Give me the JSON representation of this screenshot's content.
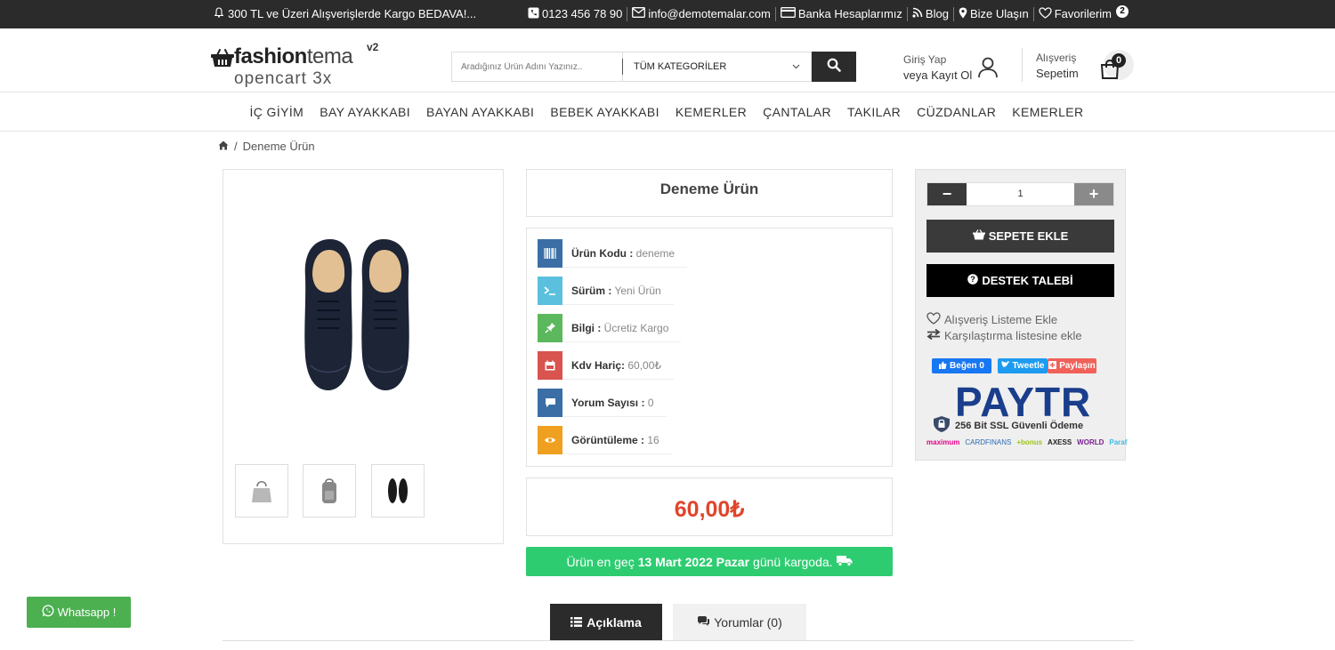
{
  "topbar": {
    "notice": "300 TL ve Üzeri Alışverişlerde Kargo BEDAVA!...",
    "phone": "0123 456 78 90",
    "email": "info@demotemalar.com",
    "bank": "Banka Hesaplarımız",
    "blog": "Blog",
    "contact": "Bize Ulaşın",
    "favorites": "Favorilerim",
    "favorites_count": "2"
  },
  "logo": {
    "part1": "fashion",
    "part2": "tema",
    "version": "v2",
    "sub": "opencart 3x"
  },
  "search": {
    "placeholder": "Aradığınız Ürün Adını Yazınız..",
    "category": "TÜM KATEGORİLER"
  },
  "account": {
    "login": "Giriş Yap",
    "register": "veya Kayıt Ol"
  },
  "cart": {
    "line1": "Alışveriş",
    "line2": "Sepetim",
    "count": "0"
  },
  "nav": [
    "İÇ GİYİM",
    "BAY AYAKKABI",
    "BAYAN AYAKKABI",
    "BEBEK AYAKKABI",
    "KEMERLER",
    "ÇANTALAR",
    "TAKILAR",
    "CÜZDANLAR",
    "KEMERLER"
  ],
  "breadcrumb": {
    "current": "Deneme Ürün"
  },
  "product": {
    "title": "Deneme Ürün",
    "info": [
      {
        "label": "Ürün Kodu :",
        "value": "deneme",
        "color": "#3a6ea5"
      },
      {
        "label": "Sürüm :",
        "value": "Yeni Ürün",
        "color": "#5bc0de"
      },
      {
        "label": "Bilgi :",
        "value": "Ücretiz Kargo",
        "color": "#5cb85c"
      },
      {
        "label": "Kdv Hariç:",
        "value": "60,00₺",
        "color": "#d9534f"
      },
      {
        "label": "Yorum Sayısı :",
        "value": "0",
        "color": "#3a6ea5"
      },
      {
        "label": "Görüntüleme :",
        "value": "16",
        "color": "#f0a020"
      }
    ],
    "price": "60,00₺",
    "shipping_pre": "Ürün en geç",
    "shipping_date": "13 Mart 2022 Pazar",
    "shipping_post": "günü kargoda."
  },
  "side": {
    "qty_minus": "−",
    "qty": "1",
    "qty_plus": "+",
    "add_to_cart": "SEPETE EKLE",
    "support": "DESTEK TALEBİ",
    "wishlist": "Alışveriş Listeme Ekle",
    "compare": "Karşılaştırma listesine ekle",
    "like": "Beğen 0",
    "tweet": "Tweetle",
    "share": "Paylaşın",
    "paytr": "PAYTR",
    "ssl": "256 Bit SSL Güvenli Ödeme",
    "banks": [
      "maximum",
      "CARDFINANS",
      "+bonus",
      "AXESS",
      "WORLD",
      "Paraf"
    ]
  },
  "tabs": {
    "description": "Açıklama",
    "reviews": "Yorumlar (0)"
  },
  "whatsapp": "Whatsapp !"
}
